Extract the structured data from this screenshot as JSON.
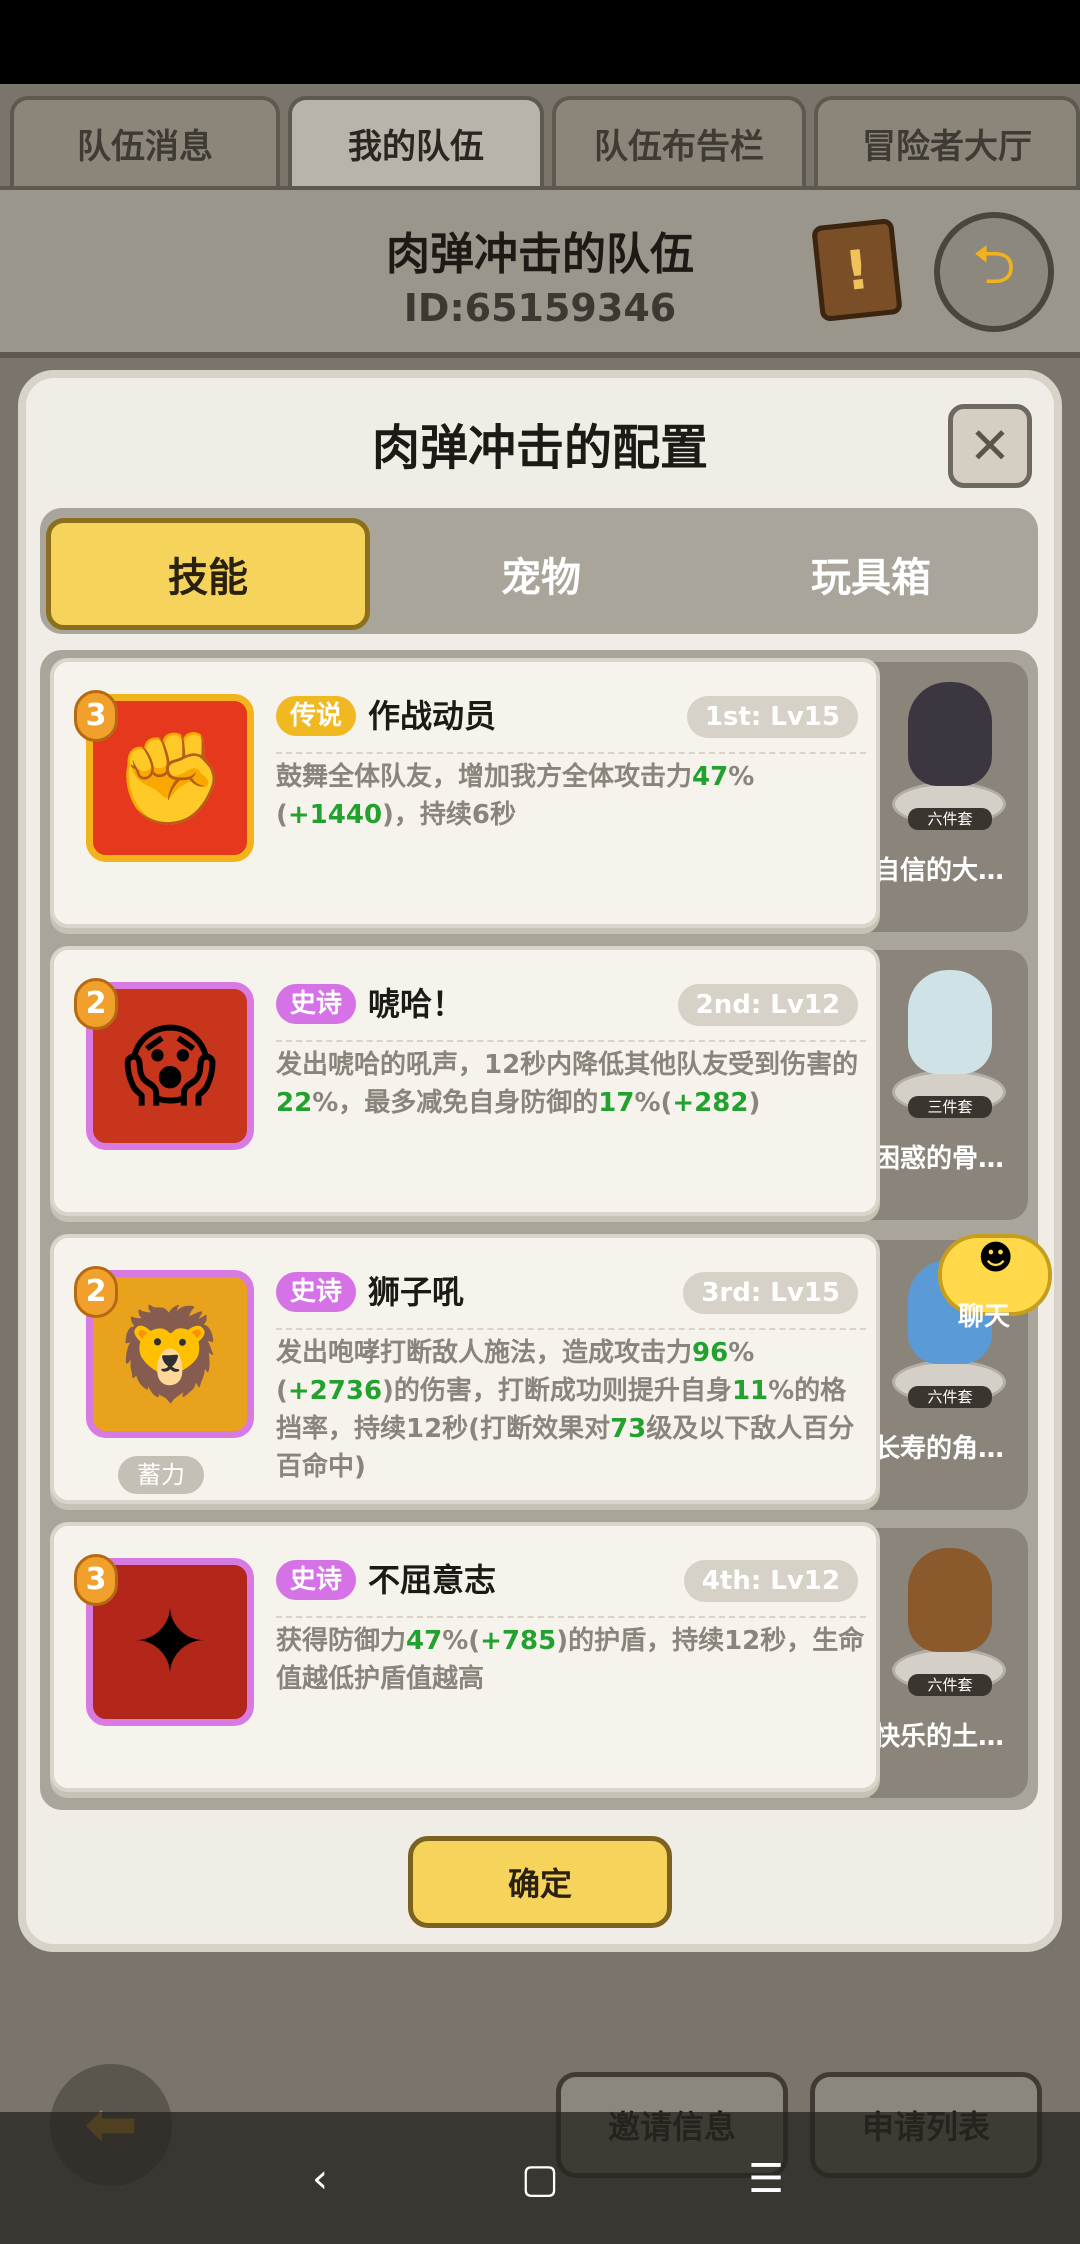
{
  "top_tabs": [
    "队伍消息",
    "我的队伍",
    "队伍布告栏",
    "冒险者大厅"
  ],
  "team": {
    "title": "肉弹冲击的队伍",
    "id": "ID:65159346"
  },
  "modal": {
    "title": "肉弹冲击的配置",
    "tabs": [
      "技能",
      "宠物",
      "玩具箱"
    ],
    "confirm_label": "确定"
  },
  "skills": [
    {
      "rarity": "传说",
      "name": "作战动员",
      "slot": "1st: Lv15",
      "badge": "3",
      "desc_parts": [
        "鼓舞全体队友，增加我方全体攻击力",
        "47",
        "%(",
        "+1440",
        ")，持续6秒"
      ]
    },
    {
      "rarity": "史诗",
      "name": "唬哈！",
      "slot": "2nd: Lv12",
      "badge": "2",
      "desc_parts": [
        "发出唬哈的吼声，12秒内降低其他队友受到伤害的",
        "22",
        "%，最多减免自身防御的",
        "17",
        "%(",
        "+282",
        ")"
      ]
    },
    {
      "rarity": "史诗",
      "name": "狮子吼",
      "slot": "3rd: Lv15",
      "badge": "2",
      "tag": "蓄力",
      "desc_parts": [
        "发出咆哮打断敌人施法，造成攻击力",
        "96",
        "%(",
        "+2736",
        ")的伤害，打断成功则提升自身",
        "11",
        "%的格挡率，持续12秒(打断效果对",
        "73",
        "级及以下敌人百分百命中)"
      ]
    },
    {
      "rarity": "史诗",
      "name": "不屈意志",
      "slot": "4th: Lv12",
      "badge": "3",
      "desc_parts": [
        "获得防御力",
        "47",
        "%(",
        "+785",
        ")的护盾，持续12秒，生命值越低护盾值越高"
      ]
    }
  ],
  "pets": [
    {
      "name": "自信的大…",
      "set": "六件套"
    },
    {
      "name": "困惑的骨…",
      "set": "三件套"
    },
    {
      "name": "长寿的角…",
      "set": "六件套"
    },
    {
      "name": "快乐的土…",
      "set": "六件套"
    }
  ],
  "chat_label": "聊天",
  "bottom": {
    "invite_label": "邀请信息",
    "apply_label": "申请列表"
  },
  "icons": [
    "exit-icon",
    "quest-scroll-icon",
    "close-icon",
    "back-arrow-icon",
    "chat-icon"
  ]
}
